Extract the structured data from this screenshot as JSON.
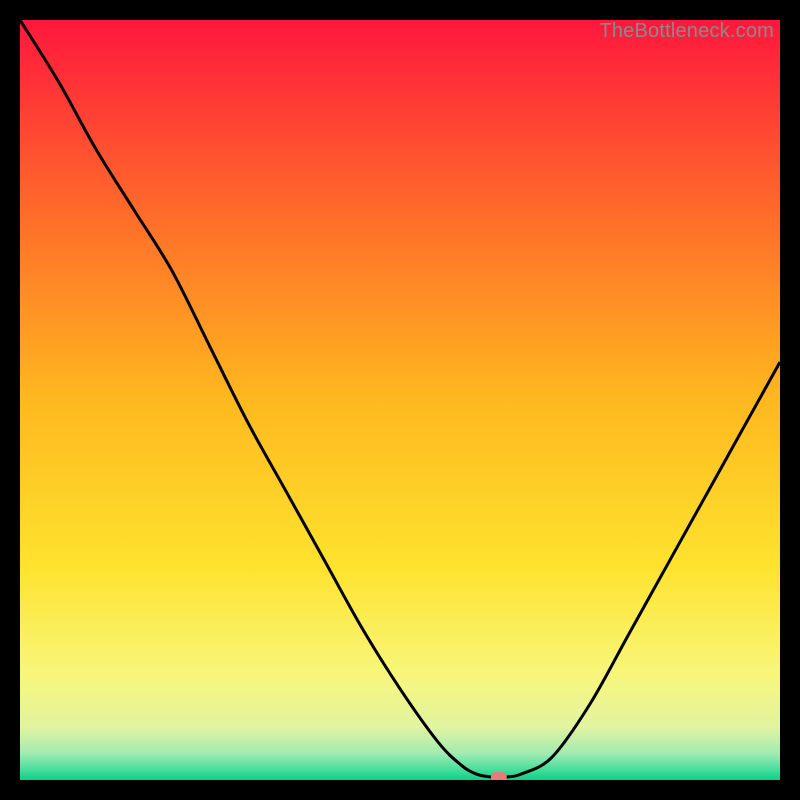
{
  "watermark": "TheBottleneck.com",
  "chart_data": {
    "type": "line",
    "title": "",
    "xlabel": "",
    "ylabel": "",
    "xlim": [
      0,
      100
    ],
    "ylim": [
      0,
      100
    ],
    "grid": false,
    "legend": false,
    "series": [
      {
        "name": "curve",
        "x": [
          0,
          5,
          10,
          15,
          20,
          25,
          30,
          35,
          40,
          45,
          50,
          55,
          58,
          60,
          62,
          64,
          66,
          70,
          75,
          80,
          85,
          90,
          95,
          100
        ],
        "y": [
          100,
          92,
          83,
          75,
          67,
          57,
          47,
          38,
          29,
          20,
          12,
          5,
          2,
          0.8,
          0.4,
          0.4,
          0.8,
          3,
          10,
          19,
          28,
          37,
          46,
          55
        ]
      }
    ],
    "marker": {
      "x": 63,
      "y": 0.4
    },
    "background_gradient": {
      "type": "vertical",
      "stops": [
        {
          "pos": 0.0,
          "color": "#ff173d"
        },
        {
          "pos": 0.25,
          "color": "#ff6a2a"
        },
        {
          "pos": 0.5,
          "color": "#ffb81f"
        },
        {
          "pos": 0.72,
          "color": "#fee32e"
        },
        {
          "pos": 0.86,
          "color": "#f8f67a"
        },
        {
          "pos": 0.93,
          "color": "#e2f4a0"
        },
        {
          "pos": 0.965,
          "color": "#a2ebb1"
        },
        {
          "pos": 0.985,
          "color": "#4ddf9d"
        },
        {
          "pos": 1.0,
          "color": "#0ad18b"
        }
      ]
    },
    "line_color": "#000000",
    "line_width": 3,
    "marker_color": "#e77b78"
  }
}
